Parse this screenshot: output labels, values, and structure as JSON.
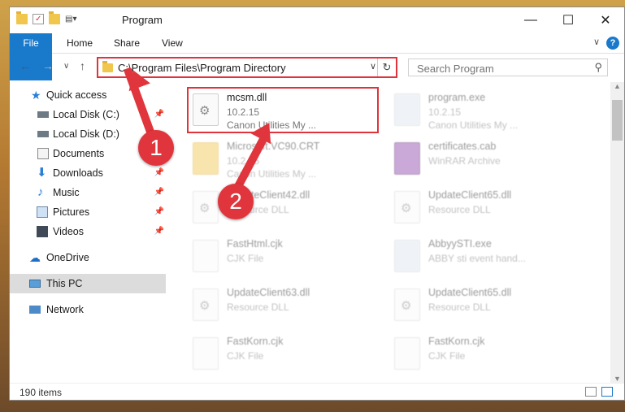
{
  "window": {
    "title": "Program"
  },
  "ribbon": {
    "tabs": [
      "File",
      "Home",
      "Share",
      "View"
    ],
    "help": "?"
  },
  "address": {
    "path": "C:\\Program Files\\Program Directory",
    "search_placeholder": "Search Program"
  },
  "nav": {
    "items": [
      {
        "label": "Quick access",
        "icon": "star-icon"
      },
      {
        "label": "Local Disk (C:)",
        "icon": "drive-icon",
        "pinned": true
      },
      {
        "label": "Local Disk (D:)",
        "icon": "drive-icon"
      },
      {
        "label": "Documents",
        "icon": "documents-icon"
      },
      {
        "label": "Downloads",
        "icon": "download-icon",
        "pinned": true
      },
      {
        "label": "Music",
        "icon": "music-icon",
        "pinned": true
      },
      {
        "label": "Pictures",
        "icon": "pictures-icon",
        "pinned": true
      },
      {
        "label": "Videos",
        "icon": "videos-icon",
        "pinned": true
      },
      {
        "label": "OneDrive",
        "icon": "cloud-icon"
      },
      {
        "label": "This PC",
        "icon": "pc-icon",
        "selected": true
      },
      {
        "label": "Network",
        "icon": "network-icon"
      }
    ]
  },
  "files": [
    {
      "name": "mcsm.dll",
      "line1": "10.2.15",
      "line2": "Canon Utilities My ...",
      "highlighted": true
    },
    {
      "name": "program.exe",
      "line1": "10.2.15",
      "line2": "Canon Utilities My ..."
    },
    {
      "name": "Microsoft.VC90.CRT",
      "line1": "10.2.15",
      "line2": "Canon Utilities My ..."
    },
    {
      "name": "certificates.cab",
      "line1": "WinRAR Archive",
      "line2": ""
    },
    {
      "name": "UpdateClient42.dll",
      "line1": "Resource DLL",
      "line2": ""
    },
    {
      "name": "UpdateClient65.dll",
      "line1": "Resource DLL",
      "line2": ""
    },
    {
      "name": "FastHtml.cjk",
      "line1": "CJK File",
      "line2": ""
    },
    {
      "name": "AbbyySTI.exe",
      "line1": "ABBY sti event hand...",
      "line2": ""
    },
    {
      "name": "UpdateClient63.dll",
      "line1": "Resource DLL",
      "line2": ""
    },
    {
      "name": "UpdateClient65.dll",
      "line1": "Resource DLL",
      "line2": ""
    },
    {
      "name": "FastKorn.cjk",
      "line1": "CJK File",
      "line2": ""
    },
    {
      "name": "FastKorn.cjk",
      "line1": "CJK File",
      "line2": ""
    }
  ],
  "status": {
    "count": "190 items"
  },
  "annotations": {
    "step1": "1",
    "step2": "2",
    "color": "#e0353c"
  }
}
